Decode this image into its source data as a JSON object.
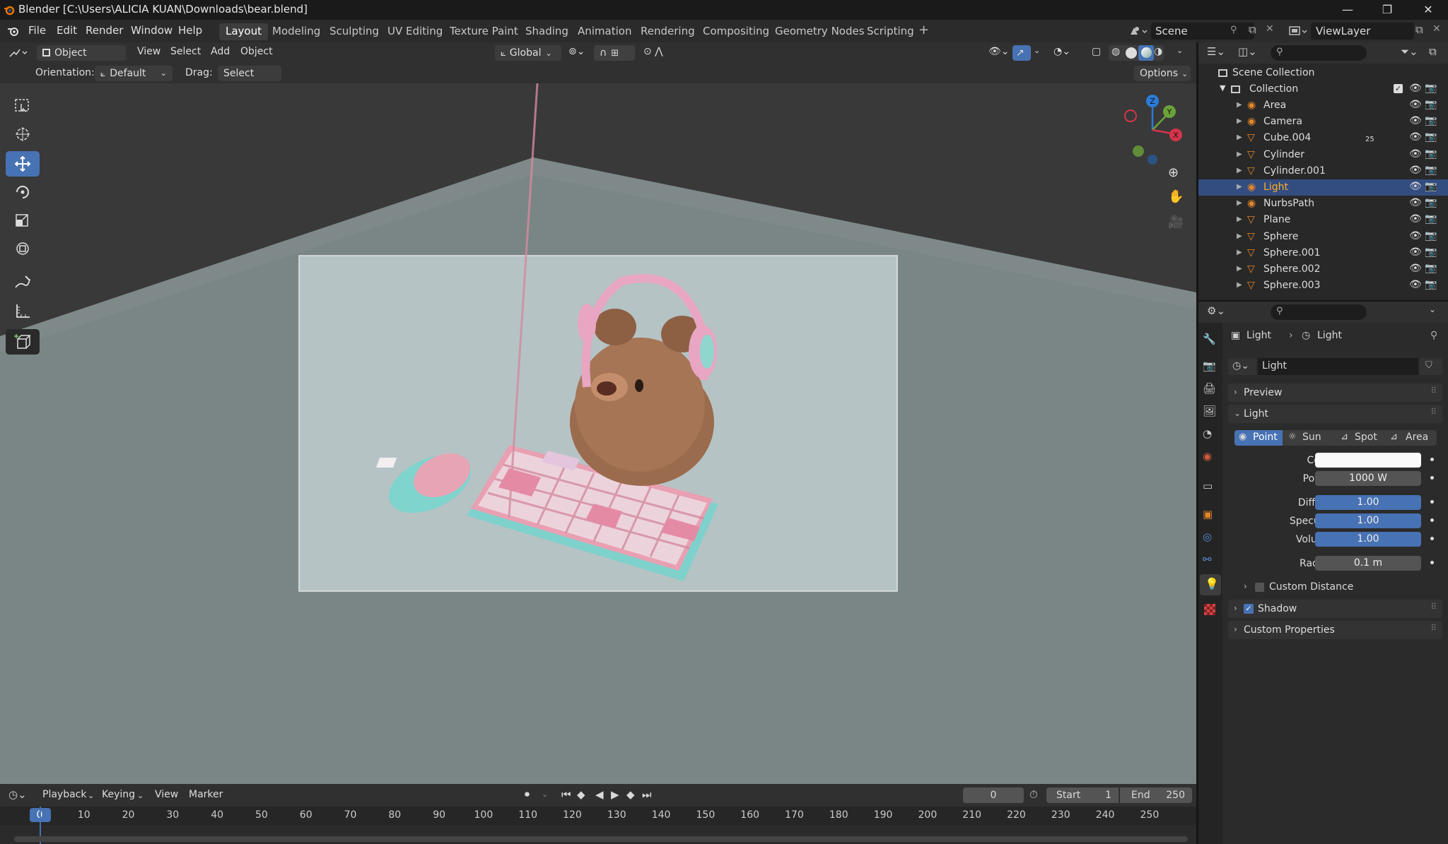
{
  "titlebar": {
    "title": "Blender [C:\\Users\\ALICIA KUAN\\Downloads\\bear.blend]"
  },
  "menu": {
    "items": [
      "File",
      "Edit",
      "Render",
      "Window",
      "Help"
    ]
  },
  "workspaces": [
    "Layout",
    "Modeling",
    "Sculpting",
    "UV Editing",
    "Texture Paint",
    "Shading",
    "Animation",
    "Rendering",
    "Compositing",
    "Geometry Nodes",
    "Scripting"
  ],
  "scene": {
    "label": "Scene",
    "view_layer": "ViewLayer"
  },
  "viewport_header": {
    "mode": "Object Mode",
    "menus": [
      "View",
      "Select",
      "Add",
      "Object"
    ],
    "transform": "Global"
  },
  "tool_settings": {
    "orientation_label": "Orientation:",
    "orientation_value": "Default",
    "drag_label": "Drag:",
    "drag_value": "Select Box",
    "options": "Options"
  },
  "gizmo": {
    "x": "X",
    "y": "Y",
    "z": "Z"
  },
  "outliner": {
    "scene_collection": "Scene Collection",
    "collection": "Collection",
    "objects": [
      "Area",
      "Camera",
      "Cube.004",
      "Cylinder",
      "Cylinder.001",
      "Light",
      "NurbsPath",
      "Plane",
      "Sphere",
      "Sphere.001",
      "Sphere.002",
      "Sphere.003"
    ],
    "selected": "Light",
    "cube_badge": "25"
  },
  "properties": {
    "breadcrumb_object": "Light",
    "breadcrumb_data": "Light",
    "datablock": "Light",
    "preview": "Preview",
    "light_panel": "Light",
    "types": [
      "Point",
      "Sun",
      "Spot",
      "Area"
    ],
    "color_label": "Color",
    "power_label": "Power",
    "power_value": "1000 W",
    "diffuse_label": "Diffuse",
    "diffuse_value": "1.00",
    "specular_label": "Specular",
    "specular_value": "1.00",
    "volume_label": "Volume",
    "volume_value": "1.00",
    "radius_label": "Radius",
    "radius_value": "0.1 m",
    "custom_distance": "Custom Distance",
    "shadow": "Shadow",
    "custom_properties": "Custom Properties"
  },
  "timeline": {
    "menus": [
      "Playback",
      "Keying",
      "View",
      "Marker"
    ],
    "current_frame": "0",
    "start_label": "Start",
    "start_value": "1",
    "end_label": "End",
    "end_value": "250",
    "ticks": [
      "0",
      "10",
      "20",
      "30",
      "40",
      "50",
      "60",
      "70",
      "80",
      "90",
      "100",
      "110",
      "120",
      "130",
      "140",
      "150",
      "160",
      "170",
      "180",
      "190",
      "200",
      "210",
      "220",
      "230",
      "240",
      "250"
    ]
  },
  "colors": {
    "accent": "#4772b3",
    "selected_row": "#334d80",
    "active_object": "#ffaf29"
  }
}
